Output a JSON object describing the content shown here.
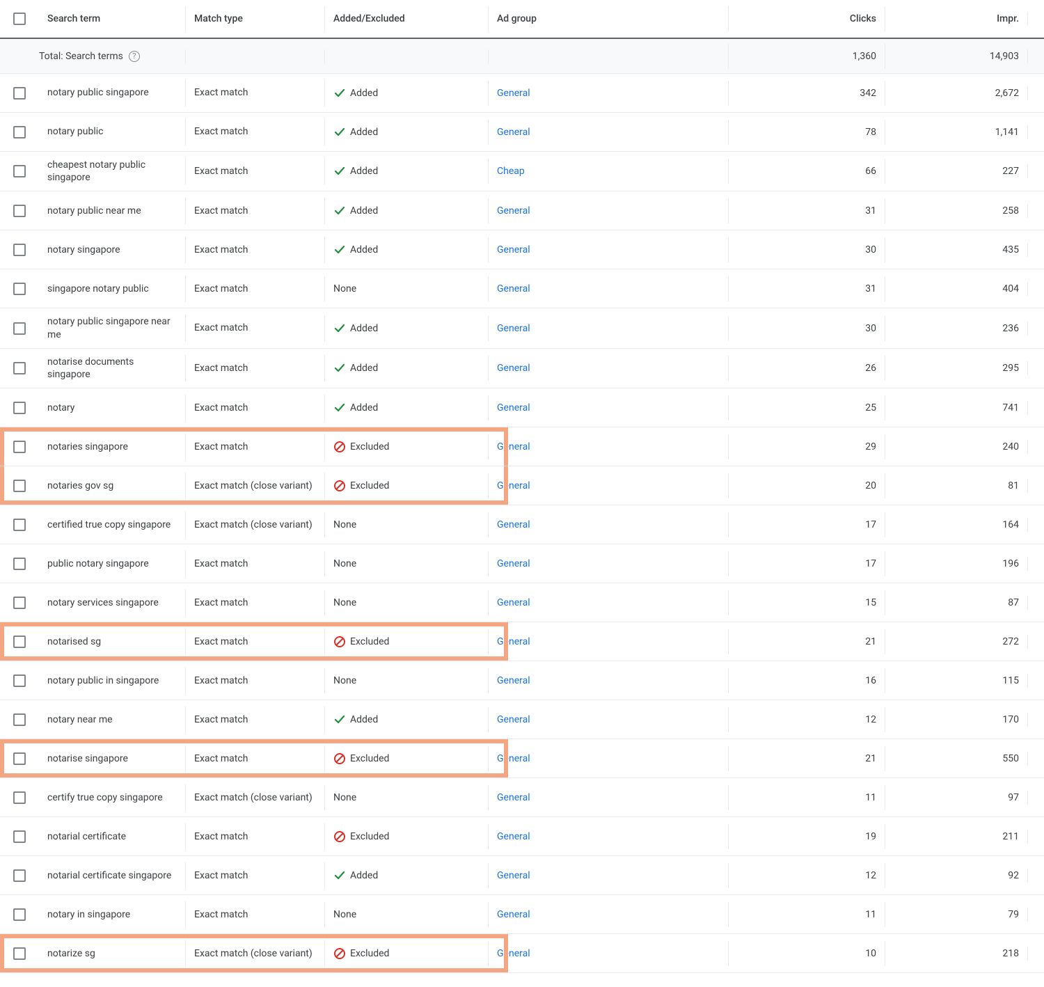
{
  "headers": {
    "search_term": "Search term",
    "match_type": "Match type",
    "added_excluded": "Added/Excluded",
    "ad_group": "Ad group",
    "clicks": "Clicks",
    "impr": "Impr."
  },
  "totals": {
    "label": "Total: Search terms",
    "clicks": "1,360",
    "impr": "14,903"
  },
  "status_labels": {
    "added": "Added",
    "excluded": "Excluded",
    "none": "None"
  },
  "rows": [
    {
      "term": "notary public singapore",
      "match": "Exact match",
      "status": "added",
      "group": "General",
      "clicks": "342",
      "impr": "2,672",
      "highlight": ""
    },
    {
      "term": "notary public",
      "match": "Exact match",
      "status": "added",
      "group": "General",
      "clicks": "78",
      "impr": "1,141",
      "highlight": ""
    },
    {
      "term": "cheapest notary public singapore",
      "match": "Exact match",
      "status": "added",
      "group": "Cheap",
      "clicks": "66",
      "impr": "227",
      "highlight": ""
    },
    {
      "term": "notary public near me",
      "match": "Exact match",
      "status": "added",
      "group": "General",
      "clicks": "31",
      "impr": "258",
      "highlight": ""
    },
    {
      "term": "notary singapore",
      "match": "Exact match",
      "status": "added",
      "group": "General",
      "clicks": "30",
      "impr": "435",
      "highlight": ""
    },
    {
      "term": "singapore notary public",
      "match": "Exact match",
      "status": "none",
      "group": "General",
      "clicks": "31",
      "impr": "404",
      "highlight": ""
    },
    {
      "term": "notary public singapore near me",
      "match": "Exact match",
      "status": "added",
      "group": "General",
      "clicks": "30",
      "impr": "236",
      "highlight": ""
    },
    {
      "term": "notarise documents singapore",
      "match": "Exact match",
      "status": "added",
      "group": "General",
      "clicks": "26",
      "impr": "295",
      "highlight": ""
    },
    {
      "term": "notary",
      "match": "Exact match",
      "status": "added",
      "group": "General",
      "clicks": "25",
      "impr": "741",
      "highlight": ""
    },
    {
      "term": "notaries singapore",
      "match": "Exact match",
      "status": "excluded",
      "group": "General",
      "clicks": "29",
      "impr": "240",
      "highlight": "top"
    },
    {
      "term": "notaries gov sg",
      "match": "Exact match (close variant)",
      "status": "excluded",
      "group": "General",
      "clicks": "20",
      "impr": "81",
      "highlight": "bottom"
    },
    {
      "term": "certified true copy singapore",
      "match": "Exact match (close variant)",
      "status": "none",
      "group": "General",
      "clicks": "17",
      "impr": "164",
      "highlight": ""
    },
    {
      "term": "public notary singapore",
      "match": "Exact match",
      "status": "none",
      "group": "General",
      "clicks": "17",
      "impr": "196",
      "highlight": ""
    },
    {
      "term": "notary services singapore",
      "match": "Exact match",
      "status": "none",
      "group": "General",
      "clicks": "15",
      "impr": "87",
      "highlight": ""
    },
    {
      "term": "notarised sg",
      "match": "Exact match",
      "status": "excluded",
      "group": "General",
      "clicks": "21",
      "impr": "272",
      "highlight": "single"
    },
    {
      "term": "notary public in singapore",
      "match": "Exact match",
      "status": "none",
      "group": "General",
      "clicks": "16",
      "impr": "115",
      "highlight": ""
    },
    {
      "term": "notary near me",
      "match": "Exact match",
      "status": "added",
      "group": "General",
      "clicks": "12",
      "impr": "170",
      "highlight": ""
    },
    {
      "term": "notarise singapore",
      "match": "Exact match",
      "status": "excluded",
      "group": "General",
      "clicks": "21",
      "impr": "550",
      "highlight": "single"
    },
    {
      "term": "certify true copy singapore",
      "match": "Exact match (close variant)",
      "status": "none",
      "group": "General",
      "clicks": "11",
      "impr": "97",
      "highlight": ""
    },
    {
      "term": "notarial certificate",
      "match": "Exact match",
      "status": "excluded",
      "group": "General",
      "clicks": "19",
      "impr": "211",
      "highlight": ""
    },
    {
      "term": "notarial certificate singapore",
      "match": "Exact match",
      "status": "added",
      "group": "General",
      "clicks": "12",
      "impr": "92",
      "highlight": ""
    },
    {
      "term": "notary in singapore",
      "match": "Exact match",
      "status": "none",
      "group": "General",
      "clicks": "11",
      "impr": "79",
      "highlight": ""
    },
    {
      "term": "notarize sg",
      "match": "Exact match (close variant)",
      "status": "excluded",
      "group": "General",
      "clicks": "10",
      "impr": "218",
      "highlight": "single"
    }
  ]
}
